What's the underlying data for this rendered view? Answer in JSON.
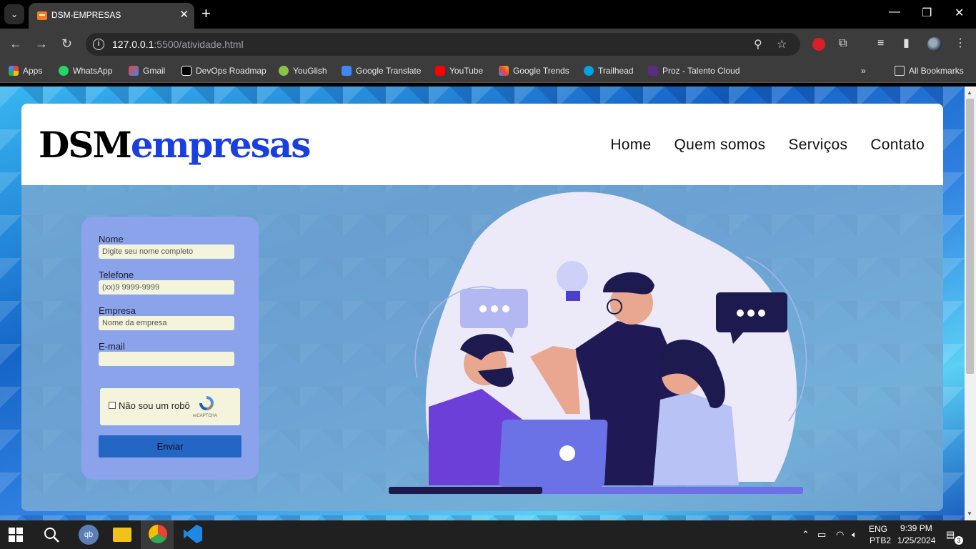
{
  "browser": {
    "tab_title": "DSM-EMPRESAS",
    "url_host": "127.0.0.1",
    "url_rest": ":5500/atividade.html",
    "bookmarks": [
      "Apps",
      "WhatsApp",
      "Gmail",
      "DevOps Roadmap",
      "YouGlish",
      "Google Translate",
      "YouTube",
      "Google Trends",
      "Trailhead",
      "Proz - Talento Cloud"
    ],
    "all_bookmarks": "All Bookmarks"
  },
  "site": {
    "logo_part1": "DSM",
    "logo_part2": "empresas",
    "nav": [
      "Home",
      "Quem somos",
      "Serviços",
      "Contato"
    ]
  },
  "form": {
    "nome_label": "Nome",
    "nome_placeholder": "Digite seu nome completo",
    "telefone_label": "Telefone",
    "telefone_placeholder": "(xx)9 9999-9999",
    "empresa_label": "Empresa",
    "empresa_placeholder": "Nome da empresa",
    "email_label": "E-mail",
    "email_placeholder": "",
    "captcha_text": "Não sou um robô",
    "captcha_brand": "reCAPTCHA",
    "submit_label": "Enviar"
  },
  "taskbar": {
    "lang": "ENG",
    "layout": "PTB2",
    "time": "9:39 PM",
    "date": "1/25/2024",
    "notifications": "3"
  }
}
